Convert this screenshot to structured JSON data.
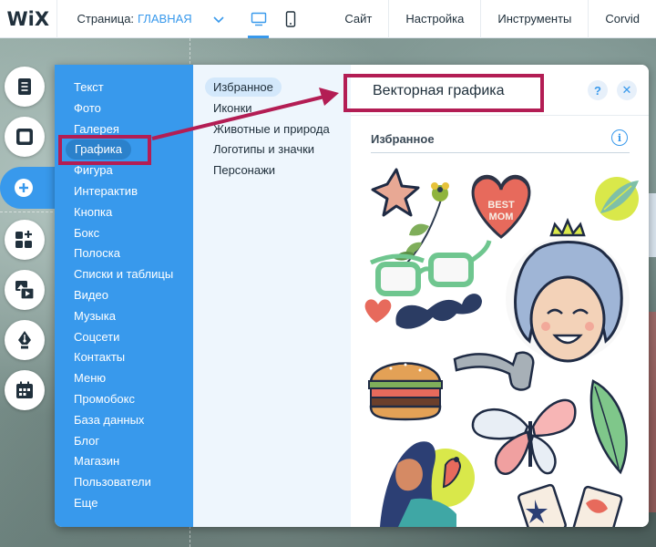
{
  "topbar": {
    "logo": "WiX",
    "page_label": "Страница:",
    "page_value": "ГЛАВНАЯ",
    "menu": [
      "Сайт",
      "Настройка",
      "Инструменты",
      "Corvid"
    ]
  },
  "tools": [
    "pages-icon",
    "background-icon",
    "add-icon",
    "apps-icon",
    "media-icon",
    "blog-pen-icon",
    "bookings-icon"
  ],
  "add_panel": {
    "categories": [
      "Текст",
      "Фото",
      "Галерея",
      "Графика",
      "Фигура",
      "Интерактив",
      "Кнопка",
      "Бокс",
      "Полоска",
      "Списки и таблицы",
      "Видео",
      "Музыка",
      "Соцсети",
      "Контакты",
      "Меню",
      "Промобокс",
      "База данных",
      "Блог",
      "Магазин",
      "Пользователи",
      "Еще"
    ],
    "selected_category": "Графика",
    "subcategories": [
      "Избранное",
      "Иконки",
      "Животные и природа",
      "Логотипы и значки",
      "Персонажи"
    ],
    "selected_subcategory": "Избранное",
    "content_title": "Векторная графика",
    "help_label": "?",
    "close_label": "✕",
    "section_title": "Избранное",
    "info_label": "i",
    "stickers": {
      "heart_line1": "BEST",
      "heart_line2": "MOM"
    }
  },
  "colors": {
    "accent": "#3899ec",
    "category_bg": "#3899ec",
    "subcategory_bg": "#eef6fd",
    "annotation": "#b31d54"
  }
}
